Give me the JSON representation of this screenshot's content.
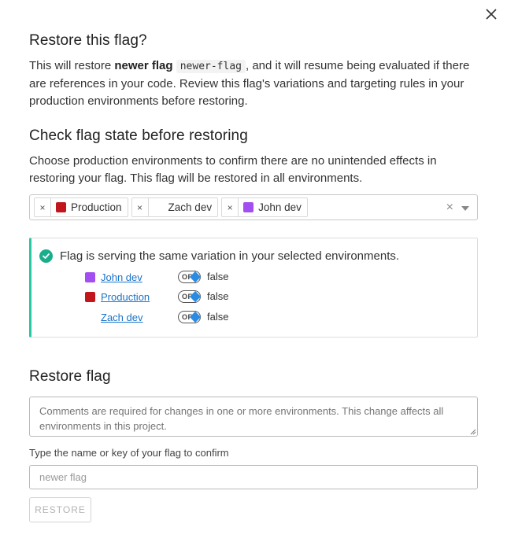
{
  "dialog": {
    "title": "Restore this flag?",
    "intro": {
      "before": "This will restore ",
      "flag_name": "newer flag",
      "flag_key": "newer-flag",
      "after": ", and it will resume being evaluated if there are references in your code. Review this flag's variations and targeting rules in your production environments before restoring."
    }
  },
  "check_section": {
    "title": "Check flag state before restoring",
    "description": "Choose production environments to confirm there are no unintended effects in restoring your flag. This flag will be restored in all environments.",
    "selected_envs": [
      {
        "label": "Production",
        "color": "#c0161c"
      },
      {
        "label": "Zach dev",
        "color": "#ffffff"
      },
      {
        "label": "John dev",
        "color": "#a24ef0"
      }
    ],
    "clear_glyph": "×",
    "remove_glyph": "×"
  },
  "status_panel": {
    "message": "Flag is serving the same variation in your selected environments.",
    "accent_color": "#28c7a4",
    "rows": [
      {
        "env": "John dev",
        "color": "#a24ef0",
        "state": "OFF",
        "variation": "false"
      },
      {
        "env": "Production",
        "color": "#c0161c",
        "state": "OFF",
        "variation": "false"
      },
      {
        "env": "Zach dev",
        "color": "#ffffff",
        "state": "OFF",
        "variation": "false"
      }
    ]
  },
  "restore_section": {
    "title": "Restore flag",
    "comment_placeholder": "Comments are required for changes in one or more environments. This change affects all environments in this project.",
    "confirm_label": "Type the name or key of your flag to confirm",
    "confirm_placeholder": "newer flag",
    "restore_button": "RESTORE"
  },
  "icons": {
    "close": "close-icon",
    "check": "check-circle-icon",
    "variation": "diamond-icon"
  }
}
